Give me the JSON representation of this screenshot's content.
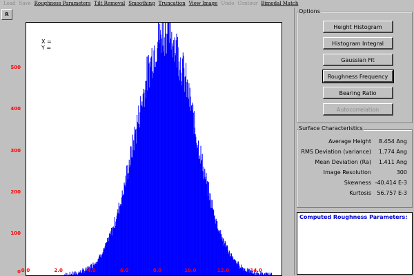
{
  "menu": [
    {
      "label": "Load",
      "enabled": false
    },
    {
      "label": "Save",
      "enabled": false
    },
    {
      "label": "Roughness Parameters",
      "enabled": true
    },
    {
      "label": "Tilt Removal",
      "enabled": true
    },
    {
      "label": "Smoothing",
      "enabled": true
    },
    {
      "label": "Truncation",
      "enabled": true
    },
    {
      "label": "View Image",
      "enabled": true
    },
    {
      "label": "Undo",
      "enabled": false
    },
    {
      "label": "Contour",
      "enabled": false
    },
    {
      "label": "Bimodal Match",
      "enabled": true
    }
  ],
  "r_button": "R",
  "cursor": {
    "x_label": "X =",
    "y_label": "Y ="
  },
  "options": {
    "title": "Options",
    "buttons": [
      {
        "label": "Height Histogram",
        "enabled": true
      },
      {
        "label": "Histogram Integral",
        "enabled": true
      },
      {
        "label": "Gaussian Fit",
        "enabled": true
      },
      {
        "label": "Roughness Frequency",
        "enabled": true
      },
      {
        "label": "Bearing Ratio",
        "enabled": true
      },
      {
        "label": "Autocorrelation",
        "enabled": false
      }
    ]
  },
  "surface": {
    "title": "Surface Characteristics",
    "rows": [
      {
        "label": "Average Height",
        "value": "8.454 Ang"
      },
      {
        "label": "RMS Deviation (variance)",
        "value": "1.774 Ang"
      },
      {
        "label": "Mean Deviation (Ra)",
        "value": "1.411 Ang"
      },
      {
        "label": "Image Resolution",
        "value": "300"
      },
      {
        "label": "Skewness",
        "value": "-40.414 E-3"
      },
      {
        "label": "Kurtosis",
        "value": "56.757 E-3"
      }
    ]
  },
  "computed": {
    "title": "Computed Roughness Parameters:"
  },
  "colors": {
    "bar": "#0000ff",
    "tick": "#ff0000"
  },
  "chart_data": {
    "type": "bar",
    "title": "",
    "xlabel": "",
    "ylabel": "",
    "xlim": [
      0.0,
      15.5
    ],
    "ylim": [
      0,
      610
    ],
    "xticks": [
      "0.0",
      "2.0",
      "4.0",
      "6.0",
      "8.0",
      "10.0",
      "12.0",
      "14.0"
    ],
    "yticks": [
      "0",
      "100",
      "200",
      "300",
      "400",
      "500"
    ],
    "distribution": {
      "mean": 8.454,
      "std": 1.774,
      "peak": 590
    }
  }
}
